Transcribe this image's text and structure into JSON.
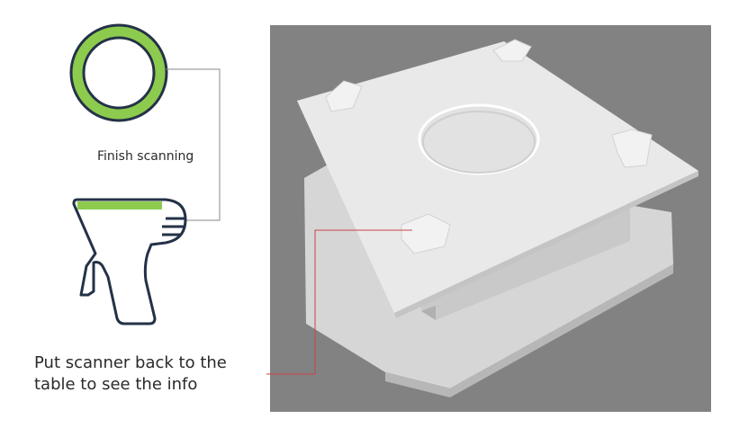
{
  "status": {
    "label": "Finish scanning",
    "ring_color": "#8dcb4e"
  },
  "scanner": {
    "bar_color": "#8dcb4e",
    "outline_color": "#243247"
  },
  "instruction": {
    "line1": "Put scanner back to the",
    "line2": "table to see the info"
  },
  "connector": {
    "color": "#c9414a",
    "bracket_color": "#8a8a8a"
  },
  "scene": {
    "background": "#828282",
    "plate_color": "#e9e9e9"
  }
}
